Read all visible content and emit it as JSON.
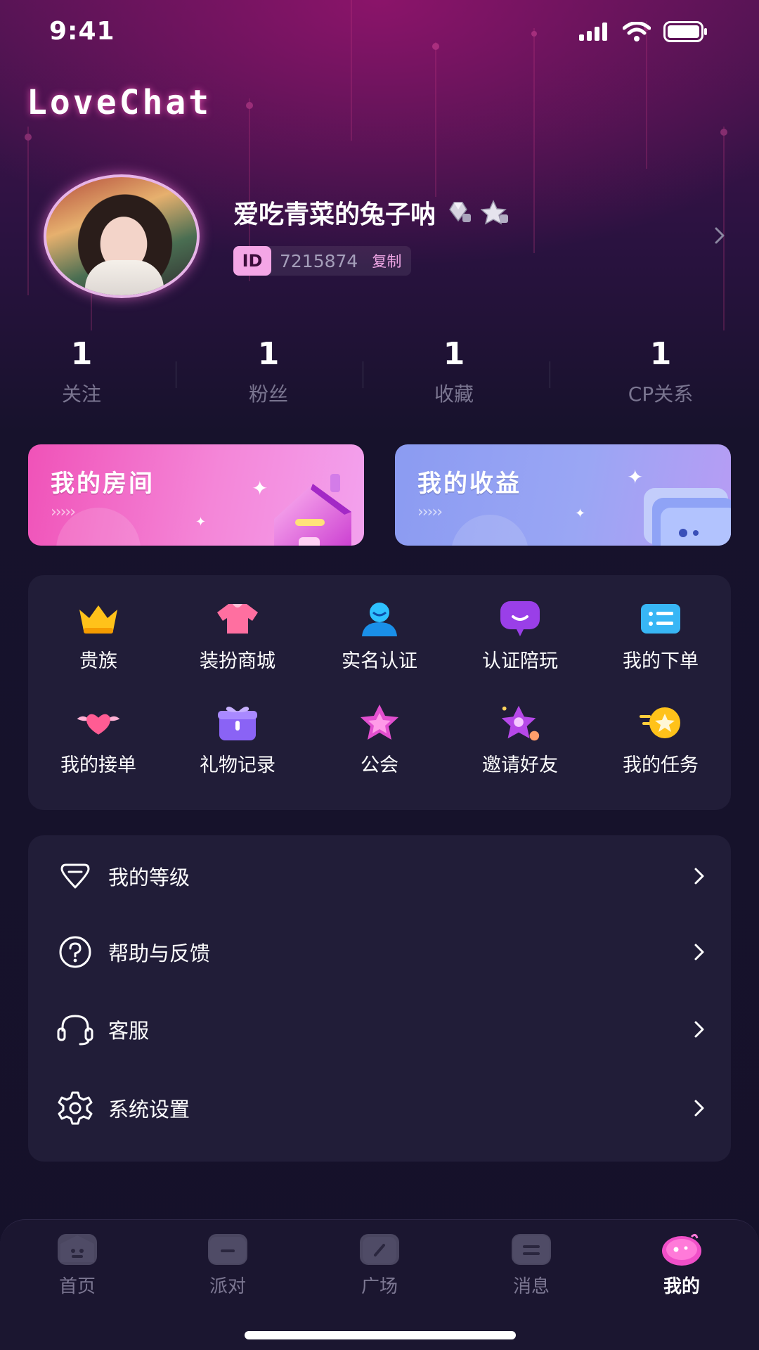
{
  "status_bar": {
    "time": "9:41"
  },
  "brand": {
    "name": "LoveChat"
  },
  "profile": {
    "name": "爱吃青菜的兔子呐",
    "id_tag": "ID",
    "id_number": "7215874",
    "copy_label": "复制"
  },
  "stats": [
    {
      "value": "1",
      "label": "关注"
    },
    {
      "value": "1",
      "label": "粉丝"
    },
    {
      "value": "1",
      "label": "收藏"
    },
    {
      "value": "1",
      "label": "CP关系"
    }
  ],
  "cards": {
    "room": {
      "title": "我的房间",
      "arrows": "›››››"
    },
    "earnings": {
      "title": "我的收益",
      "arrows": "›››››"
    }
  },
  "grid": [
    {
      "label": "贵族",
      "icon": "crown-icon"
    },
    {
      "label": "装扮商城",
      "icon": "shirt-icon"
    },
    {
      "label": "实名认证",
      "icon": "user-verify-icon"
    },
    {
      "label": "认证陪玩",
      "icon": "chat-bubble-icon"
    },
    {
      "label": "我的下单",
      "icon": "order-list-icon"
    },
    {
      "label": "我的接单",
      "icon": "winged-heart-icon"
    },
    {
      "label": "礼物记录",
      "icon": "gift-box-icon"
    },
    {
      "label": "公会",
      "icon": "guild-star-icon"
    },
    {
      "label": "邀请好友",
      "icon": "invite-star-icon"
    },
    {
      "label": "我的任务",
      "icon": "task-coin-icon"
    }
  ],
  "menu": [
    {
      "label": "我的等级",
      "icon": "diamond-level-icon"
    },
    {
      "label": "帮助与反馈",
      "icon": "help-icon"
    },
    {
      "label": "客服",
      "icon": "headset-icon"
    },
    {
      "label": "系统设置",
      "icon": "gear-icon"
    }
  ],
  "tabs": [
    {
      "label": "首页",
      "icon": "home-tab-icon",
      "active": false
    },
    {
      "label": "派对",
      "icon": "party-tab-icon",
      "active": false
    },
    {
      "label": "广场",
      "icon": "square-tab-icon",
      "active": false
    },
    {
      "label": "消息",
      "icon": "message-tab-icon",
      "active": false
    },
    {
      "label": "我的",
      "icon": "profile-tab-icon",
      "active": true
    }
  ],
  "colors": {
    "accent_pink": "#f052b8",
    "accent_purple": "#8b9bf2",
    "panel": "#211d38",
    "background": "#15112a"
  }
}
